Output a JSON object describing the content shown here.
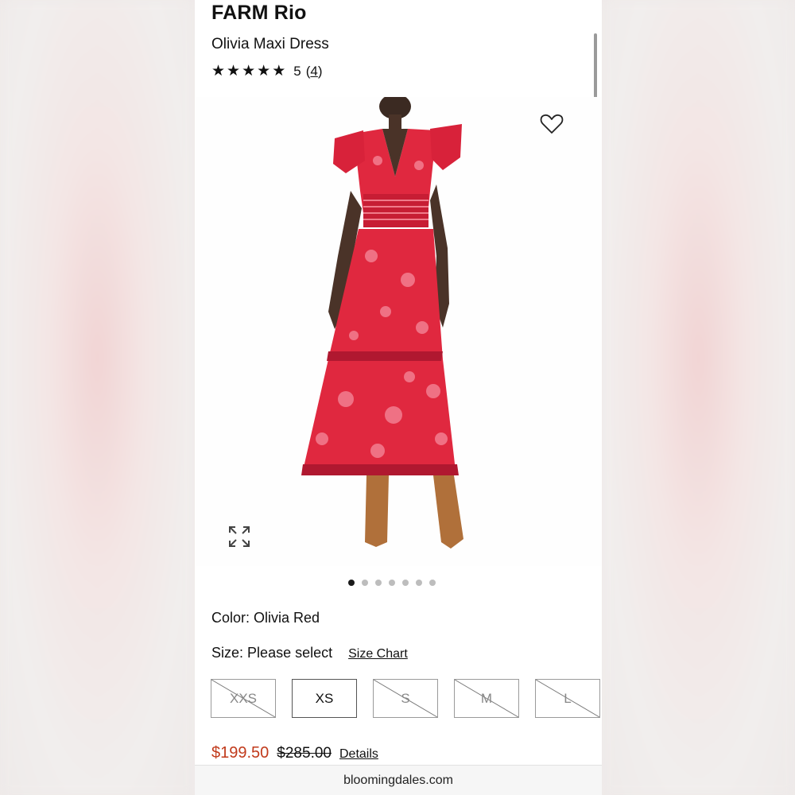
{
  "header": {
    "brand": "FARM Rio",
    "product_name": "Olivia Maxi Dress",
    "rating": {
      "stars": 5,
      "score": "5",
      "open_paren": "(",
      "count": "4",
      "close_paren": ")"
    }
  },
  "gallery": {
    "image_count": 7,
    "active_index": 0
  },
  "icons": {
    "favorite": "heart-outline-icon",
    "expand": "expand-arrows-icon",
    "star": "filled-star-icon"
  },
  "color": {
    "label": "Color:",
    "value": "Olivia Red"
  },
  "size": {
    "label": "Size:",
    "value": "Please select",
    "chart_link": "Size Chart",
    "options": [
      {
        "label": "XXS",
        "available": false
      },
      {
        "label": "XS",
        "available": true
      },
      {
        "label": "S",
        "available": false
      },
      {
        "label": "M",
        "available": false
      },
      {
        "label": "L",
        "available": false
      }
    ]
  },
  "price": {
    "sale": "$199.50",
    "original": "$285.00",
    "details_link": "Details"
  },
  "browser": {
    "url": "bloomingdales.com"
  },
  "colors": {
    "accent_price": "#c13a1b",
    "dress": "#e0283f",
    "boots": "#b0703a"
  }
}
